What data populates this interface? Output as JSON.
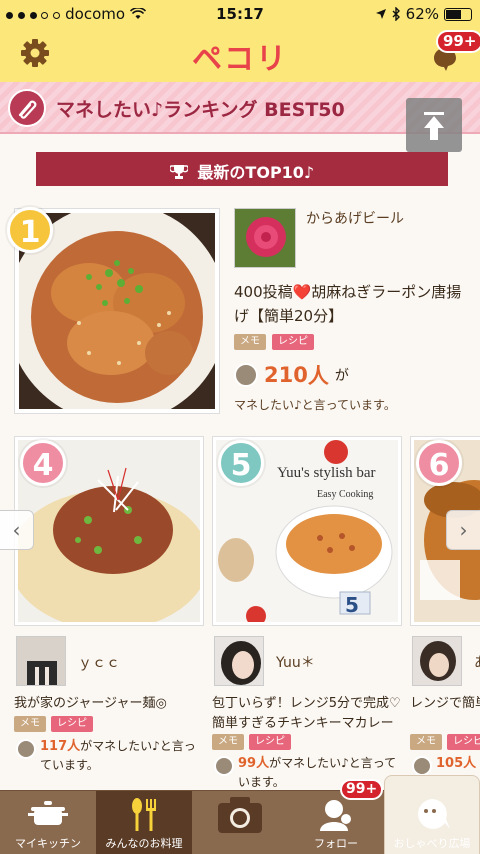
{
  "status_bar": {
    "carrier": "docomo",
    "time": "15:17",
    "battery": "62%"
  },
  "header": {
    "logo": "ペコリ",
    "notification_count": "99+"
  },
  "ranking_banner": {
    "title": "マネしたい♪ランキング BEST50"
  },
  "section_ribbon": {
    "label": "最新のTOP10♪"
  },
  "top1": {
    "rank": "1",
    "username": "からあげビール",
    "title": "400投稿❤️胡麻ねぎラーポン唐揚げ【簡単20分】",
    "tags": [
      "メモ",
      "レシピ"
    ],
    "count": "210",
    "count_unit": "人",
    "count_suffix": "が",
    "say": "マネしたい♪と言っています。"
  },
  "cards": [
    {
      "rank": "4",
      "username": "ｙｃｃ",
      "title": "我が家のジャージャー麺◎",
      "tags": [
        "メモ",
        "レシピ"
      ],
      "count": "117人",
      "say": "がマネしたい♪と言っています。"
    },
    {
      "rank": "5",
      "username": "Yuu＊",
      "title": "包丁いらず！レンジ5分で完成♡簡単すぎるチキンキーマカレー",
      "tags": [
        "メモ",
        "レシピ"
      ],
      "count": "99人",
      "say": "がマネしたい♪と言っています。",
      "photo_caption": "Yuu's stylish bar",
      "photo_subcaption": "Easy Cooking"
    },
    {
      "rank": "6",
      "username": "あ",
      "title": "レンジで簡単絶品鶏チャー",
      "tags": [
        "メモ",
        "レシピ"
      ],
      "count": "105人",
      "say": ""
    }
  ],
  "tabbar": {
    "tabs": [
      {
        "label": "マイキッチン"
      },
      {
        "label": "みんなのお料理"
      },
      {
        "label": ""
      },
      {
        "label": "フォロー"
      },
      {
        "label": "おしゃべり広場"
      }
    ],
    "follow_badge": "99+"
  },
  "colors": {
    "header_bg": "#fce87a",
    "accent": "#a52b3f",
    "logo": "#e8424a",
    "count": "#e0632d"
  }
}
